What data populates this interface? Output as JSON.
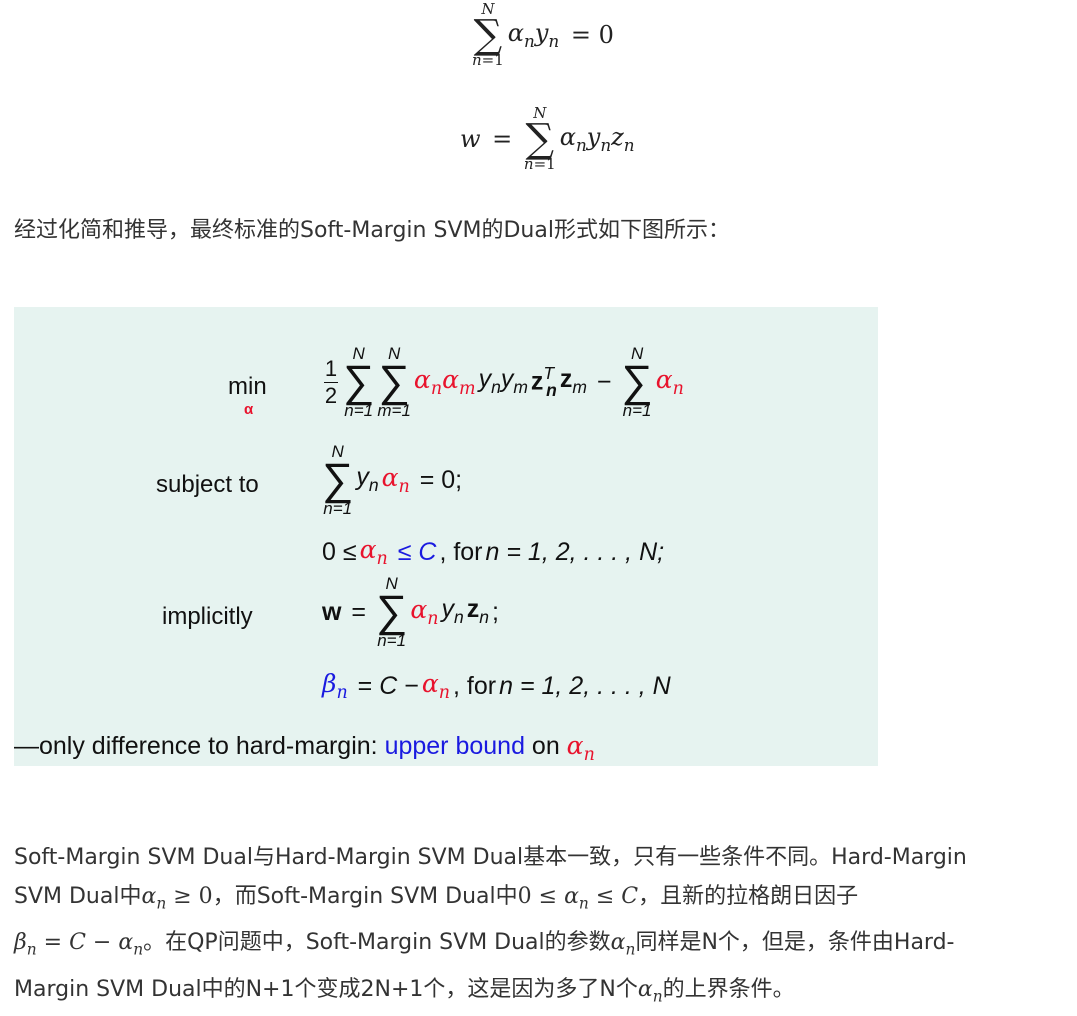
{
  "paragraphs": {
    "intro": "经过化简和推导，最终标准的Soft-Margin SVM的Dual形式如下图所示：",
    "p2_a": "Soft-Margin SVM Dual与Hard-Margin SVM Dual基本一致，只有一些条件不同。Hard-Margin",
    "p2_b": "SVM Dual中",
    "p2_c": "，而Soft-Margin SVM Dual中",
    "p2_d": "，且新的拉格朗日因子",
    "p2_e": "。在QP问题中，Soft-Margin SVM Dual的参数",
    "p2_f": "同样是N个，但是，条件由Hard-",
    "p2_g": "Margin SVM Dual中的N+1个变成2N+1个，这是因为多了N个",
    "p2_h": "的上界条件。"
  },
  "figure": {
    "labels": {
      "min": "min",
      "alpha": "α",
      "subject_to": "subject to",
      "implicitly": "implicitly"
    },
    "note_prefix": "—only difference to hard-margin: ",
    "note_highlight": "upper bound",
    "note_suffix": " on ",
    "for_text": ", for ",
    "range_text": "n = 1, 2, . . . , N;",
    "range_text2": "n = 1, 2, . . . , N"
  },
  "colors": {
    "box_background": "#e6f3f0",
    "alpha_red": "#e8132d",
    "bound_blue": "#1a1ae0"
  }
}
